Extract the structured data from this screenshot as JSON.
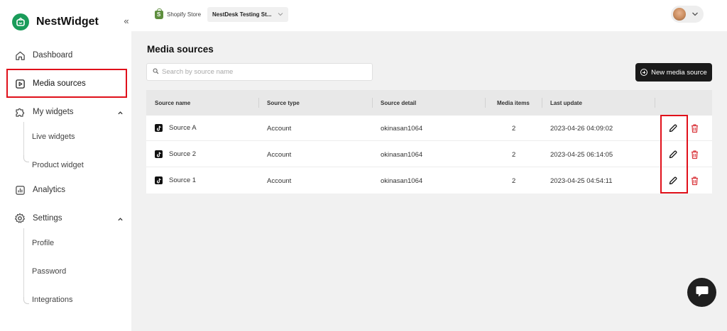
{
  "app": {
    "name": "NestWidget"
  },
  "sidebar": {
    "items": [
      {
        "label": "Dashboard"
      },
      {
        "label": "Media sources"
      },
      {
        "label": "My widgets"
      },
      {
        "label": "Analytics"
      },
      {
        "label": "Settings"
      }
    ],
    "widgets_sub": [
      {
        "label": "Live widgets"
      },
      {
        "label": "Product widget"
      }
    ],
    "settings_sub": [
      {
        "label": "Profile"
      },
      {
        "label": "Password"
      },
      {
        "label": "Integrations"
      }
    ]
  },
  "topbar": {
    "store_label": "Shopify Store",
    "store_value": "NestDesk Testing St..."
  },
  "main": {
    "title": "Media sources",
    "search_placeholder": "Search by source name",
    "new_button": "New media source",
    "columns": [
      "Source name",
      "Source type",
      "Source detail",
      "Media items",
      "Last update"
    ],
    "rows": [
      {
        "name": "Source A",
        "type": "Account",
        "detail": "okinasan1064",
        "items": "2",
        "updated": "2023-04-26 04:09:02"
      },
      {
        "name": "Source 2",
        "type": "Account",
        "detail": "okinasan1064",
        "items": "2",
        "updated": "2023-04-25 06:14:05"
      },
      {
        "name": "Source 1",
        "type": "Account",
        "detail": "okinasan1064",
        "items": "2",
        "updated": "2023-04-25 04:54:11"
      }
    ]
  },
  "colors": {
    "brand": "#1a9c5a",
    "highlight": "#e0101a",
    "delete": "#d9353b",
    "button": "#1a1a1a"
  }
}
